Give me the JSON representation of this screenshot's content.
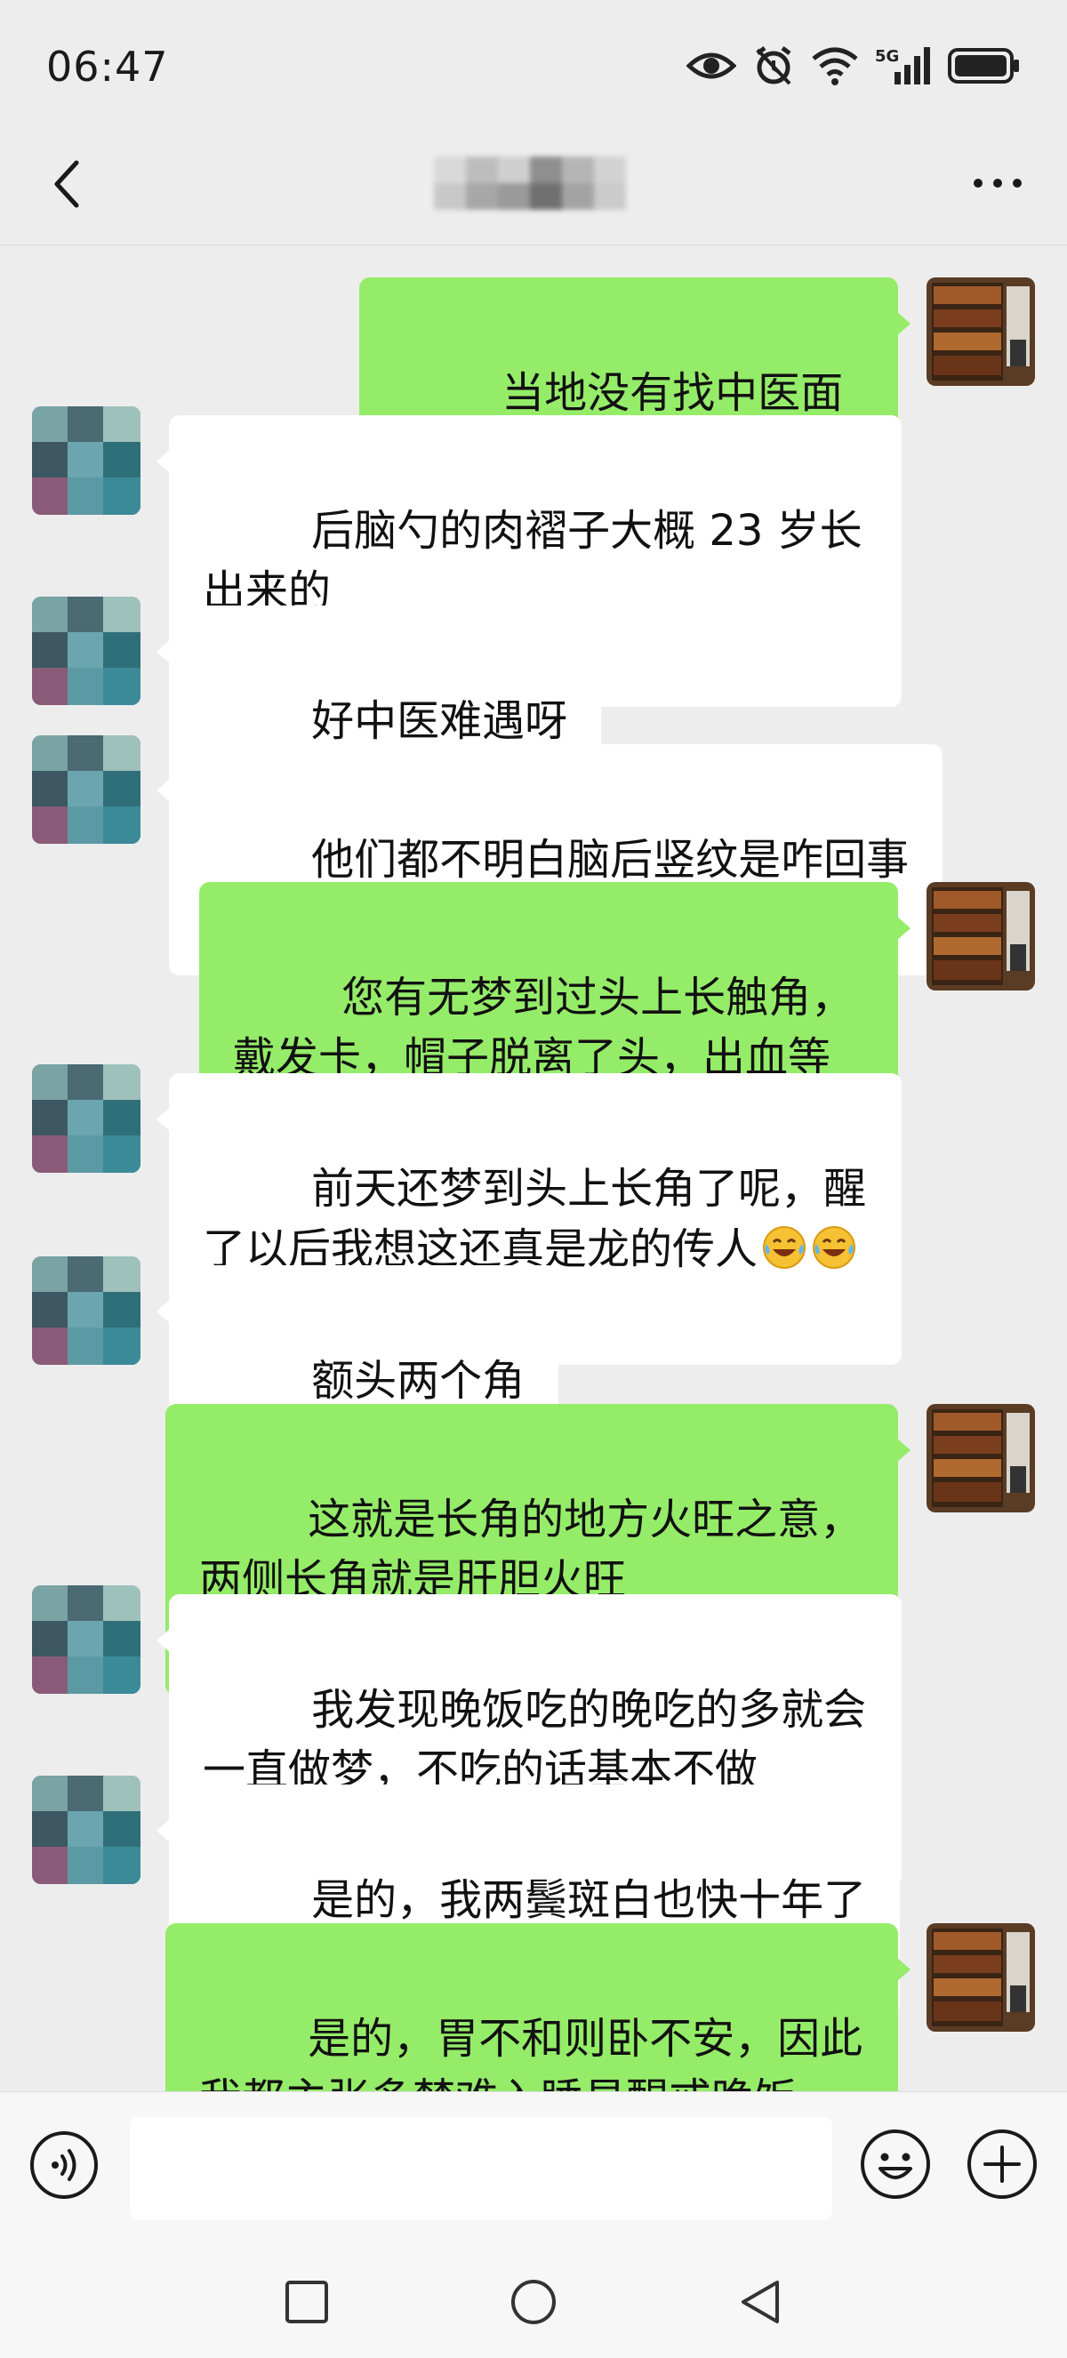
{
  "status_bar": {
    "time": "06:47",
    "icons": [
      "eye-icon",
      "alarm-icon",
      "wifi-icon",
      "signal-5g-icon",
      "battery-icon"
    ],
    "network": "5G"
  },
  "nav": {
    "title": "",
    "back_icon": "chevron-left-icon",
    "more_icon": "more-dots-icon"
  },
  "messages": [
    {
      "side": "out",
      "text": "当地没有找中医面诊过?"
    },
    {
      "side": "in",
      "text": "后脑勺的肉褶子大概 23 岁长出来的"
    },
    {
      "side": "in",
      "text": "好中医难遇呀"
    },
    {
      "side": "in",
      "text": "他们都不明白脑后竖纹是咋回事"
    },
    {
      "side": "out",
      "text": "您有无梦到过头上长触角，戴发卡，帽子脱离了头，出血等梦"
    },
    {
      "side": "in",
      "text": "前天还梦到头上长角了呢，醒了以后我想这还真是龙的传人",
      "emojis": [
        "laugh-cry-emoji",
        "laugh-cry-emoji"
      ]
    },
    {
      "side": "in",
      "text": "额头两个角"
    },
    {
      "side": "out",
      "text": "这就是长角的地方火旺之意，两侧长角就是肝胆火旺"
    },
    {
      "side": "in",
      "text": "我发现晚饭吃的晚吃的多就会一直做梦，不吃的话基本不做"
    },
    {
      "side": "in",
      "text": "是的，我两鬓斑白也快十年了"
    },
    {
      "side": "out",
      "text": "是的，胃不和则卧不安，因此我都主张多梦难入睡易醒戒晚饭"
    }
  ],
  "input_bar": {
    "value": "",
    "voice_icon": "voice-icon",
    "emoji_icon": "emoji-icon",
    "plus_icon": "plus-icon"
  },
  "colors": {
    "background": "#ededed",
    "outgoing_bubble": "#95ec69",
    "incoming_bubble": "#ffffff",
    "text": "#111111"
  }
}
